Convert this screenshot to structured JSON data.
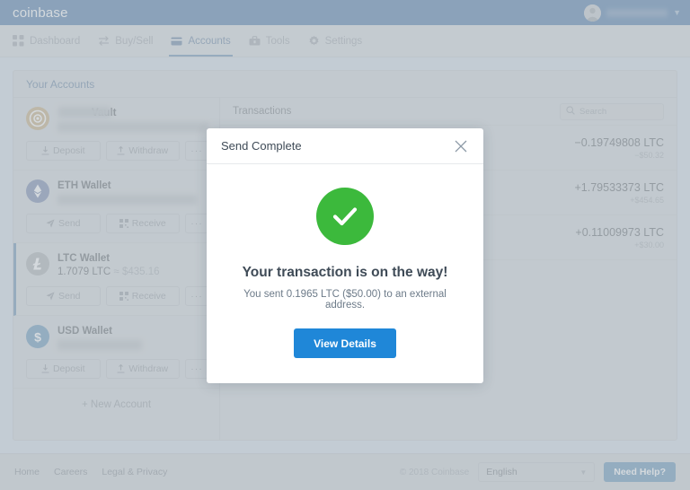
{
  "brand": {
    "name": "coinbase",
    "avatar_icon": "user-avatar-icon",
    "chevron_icon": "chevron-down-icon"
  },
  "nav": {
    "items": [
      {
        "label": "Dashboard",
        "icon": "grid-icon",
        "active": false
      },
      {
        "label": "Buy/Sell",
        "icon": "exchange-arrows-icon",
        "active": false
      },
      {
        "label": "Accounts",
        "icon": "wallet-icon",
        "active": true
      },
      {
        "label": "Tools",
        "icon": "toolbox-icon",
        "active": false
      },
      {
        "label": "Settings",
        "icon": "gear-icon",
        "active": false
      }
    ]
  },
  "card": {
    "title": "Your Accounts"
  },
  "accounts": {
    "new_account_label": "+ New Account",
    "items": [
      {
        "name": "Vault",
        "icon": "vault-target-icon",
        "balance": "",
        "balance_blurred": true,
        "name_prefix_blurred": true,
        "selected": false,
        "buttons": [
          {
            "label": "Deposit",
            "icon": "download-arrow-icon"
          },
          {
            "label": "Withdraw",
            "icon": "upload-arrow-icon"
          },
          {
            "label": "···",
            "icon": "more-dots-icon"
          }
        ]
      },
      {
        "name": "ETH Wallet",
        "icon": "ethereum-icon",
        "balance": "",
        "balance_blurred": true,
        "name_prefix_blurred": false,
        "selected": false,
        "buttons": [
          {
            "label": "Send",
            "icon": "paper-plane-icon"
          },
          {
            "label": "Receive",
            "icon": "qr-code-icon"
          },
          {
            "label": "···",
            "icon": "more-dots-icon"
          }
        ]
      },
      {
        "name": "LTC Wallet",
        "icon": "litecoin-icon",
        "balance": "1.7079 LTC",
        "balance_usd": "≈ $435.16",
        "balance_blurred": false,
        "name_prefix_blurred": false,
        "selected": true,
        "buttons": [
          {
            "label": "Send",
            "icon": "paper-plane-icon"
          },
          {
            "label": "Receive",
            "icon": "qr-code-icon"
          },
          {
            "label": "···",
            "icon": "more-dots-icon"
          }
        ]
      },
      {
        "name": "USD Wallet",
        "icon": "usd-dollar-icon",
        "balance": "",
        "balance_blurred": true,
        "name_prefix_blurred": false,
        "selected": false,
        "buttons": [
          {
            "label": "Deposit",
            "icon": "download-arrow-icon"
          },
          {
            "label": "Withdraw",
            "icon": "upload-arrow-icon"
          },
          {
            "label": "···",
            "icon": "more-dots-icon"
          }
        ]
      }
    ]
  },
  "transactions": {
    "title": "Transactions",
    "search_placeholder": "Search",
    "search_icon": "search-icon",
    "rows": [
      {
        "crypto": "−0.19749808 LTC",
        "fiat": "−$50.32"
      },
      {
        "crypto": "+1.79533373 LTC",
        "fiat": "+$454.65"
      },
      {
        "crypto": "+0.11009973 LTC",
        "fiat": "+$30.00"
      }
    ]
  },
  "modal": {
    "title": "Send Complete",
    "close_icon": "close-icon",
    "status_icon": "check-circle-icon",
    "heading": "Your transaction is on the way!",
    "subtext": "You sent 0.1965 LTC ($50.00) to an external address.",
    "button_label": "View Details"
  },
  "footer": {
    "links": [
      "Home",
      "Careers",
      "Legal & Privacy"
    ],
    "copyright": "© 2018 Coinbase",
    "language": "English",
    "language_caret_icon": "caret-down-icon",
    "help_label": "Need Help?"
  },
  "colors": {
    "brand_blue": "#0667d0",
    "accent_blue": "#1f87d8",
    "nav_active": "#2f6fb5",
    "success_green": "#3cb93c",
    "page_bg": "#c3ccd4",
    "vault_gold": "#d29b37",
    "eth_blue": "#4c6fc4",
    "ltc_grey": "#9aa3ab",
    "usd_blue": "#1f87d8"
  }
}
